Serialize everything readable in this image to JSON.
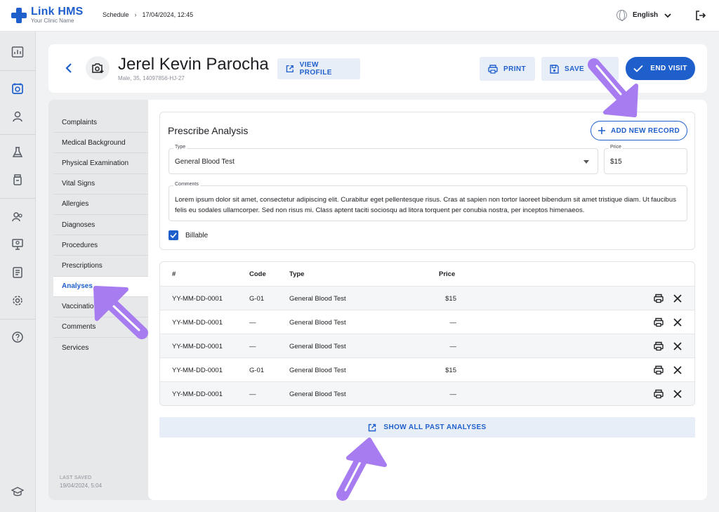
{
  "app": {
    "brand_name": "Link HMS",
    "brand_sub": "Your Clinic Name"
  },
  "breadcrumb": {
    "section": "Schedule",
    "separator": "›",
    "datetime": "17/04/2024, 12:45"
  },
  "language": {
    "selected": "English"
  },
  "patient": {
    "name": "Jerel Kevin Parocha",
    "meta": "Male, 35, 14097856-HJ-27"
  },
  "header_buttons": {
    "view_profile": "VIEW PROFILE",
    "print": "PRINT",
    "save": "SAVE",
    "end_visit": "END VISIT"
  },
  "nav": {
    "items": [
      {
        "label": "Complaints"
      },
      {
        "label": "Medical Background"
      },
      {
        "label": "Physical Examination"
      },
      {
        "label": "Vital Signs"
      },
      {
        "label": "Allergies"
      },
      {
        "label": "Diagnoses"
      },
      {
        "label": "Procedures"
      },
      {
        "label": "Prescriptions"
      },
      {
        "label": "Analyses",
        "active": true
      },
      {
        "label": "Vaccinatio"
      },
      {
        "label": "Comments"
      },
      {
        "label": "Services"
      }
    ],
    "last_saved_label": "LAST SAVED",
    "last_saved_value": "19/04/2024, 5:04"
  },
  "prescribe": {
    "title": "Prescribe Analysis",
    "add_button": "ADD NEW RECORD",
    "type_label": "Type",
    "type_value": "General Blood Test",
    "price_label": "Price",
    "price_value": "$15",
    "comments_label": "Comments",
    "comments_value": "Lorem ipsum dolor sit amet, consectetur adipiscing elit. Curabitur eget pellentesque risus. Cras at sapien non tortor laoreet bibendum sit amet tristique diam. Ut faucibus felis eu sodales ullamcorper. Sed non risus mi. Class aptent taciti sociosqu ad litora torquent per conubia nostra, per inceptos himenaeos.",
    "billable_label": "Billable",
    "billable_checked": true
  },
  "table": {
    "headers": {
      "id": "#",
      "code": "Code",
      "type": "Type",
      "price": "Price"
    },
    "rows": [
      {
        "id": "YY-MM-DD-0001",
        "code": "G-01",
        "type": "General Blood Test",
        "price": "$15"
      },
      {
        "id": "YY-MM-DD-0001",
        "code": "—",
        "type": "General Blood Test",
        "price": "—"
      },
      {
        "id": "YY-MM-DD-0001",
        "code": "—",
        "type": "General Blood Test",
        "price": "—"
      },
      {
        "id": "YY-MM-DD-0001",
        "code": "G-01",
        "type": "General Blood Test",
        "price": "$15"
      },
      {
        "id": "YY-MM-DD-0001",
        "code": "—",
        "type": "General Blood Test",
        "price": "—"
      }
    ]
  },
  "show_all": "SHOW ALL PAST ANALYSES",
  "colors": {
    "accent": "#1f5fcc",
    "accent_light": "#e8eef8",
    "annotation_arrow": "#a77cf0"
  }
}
